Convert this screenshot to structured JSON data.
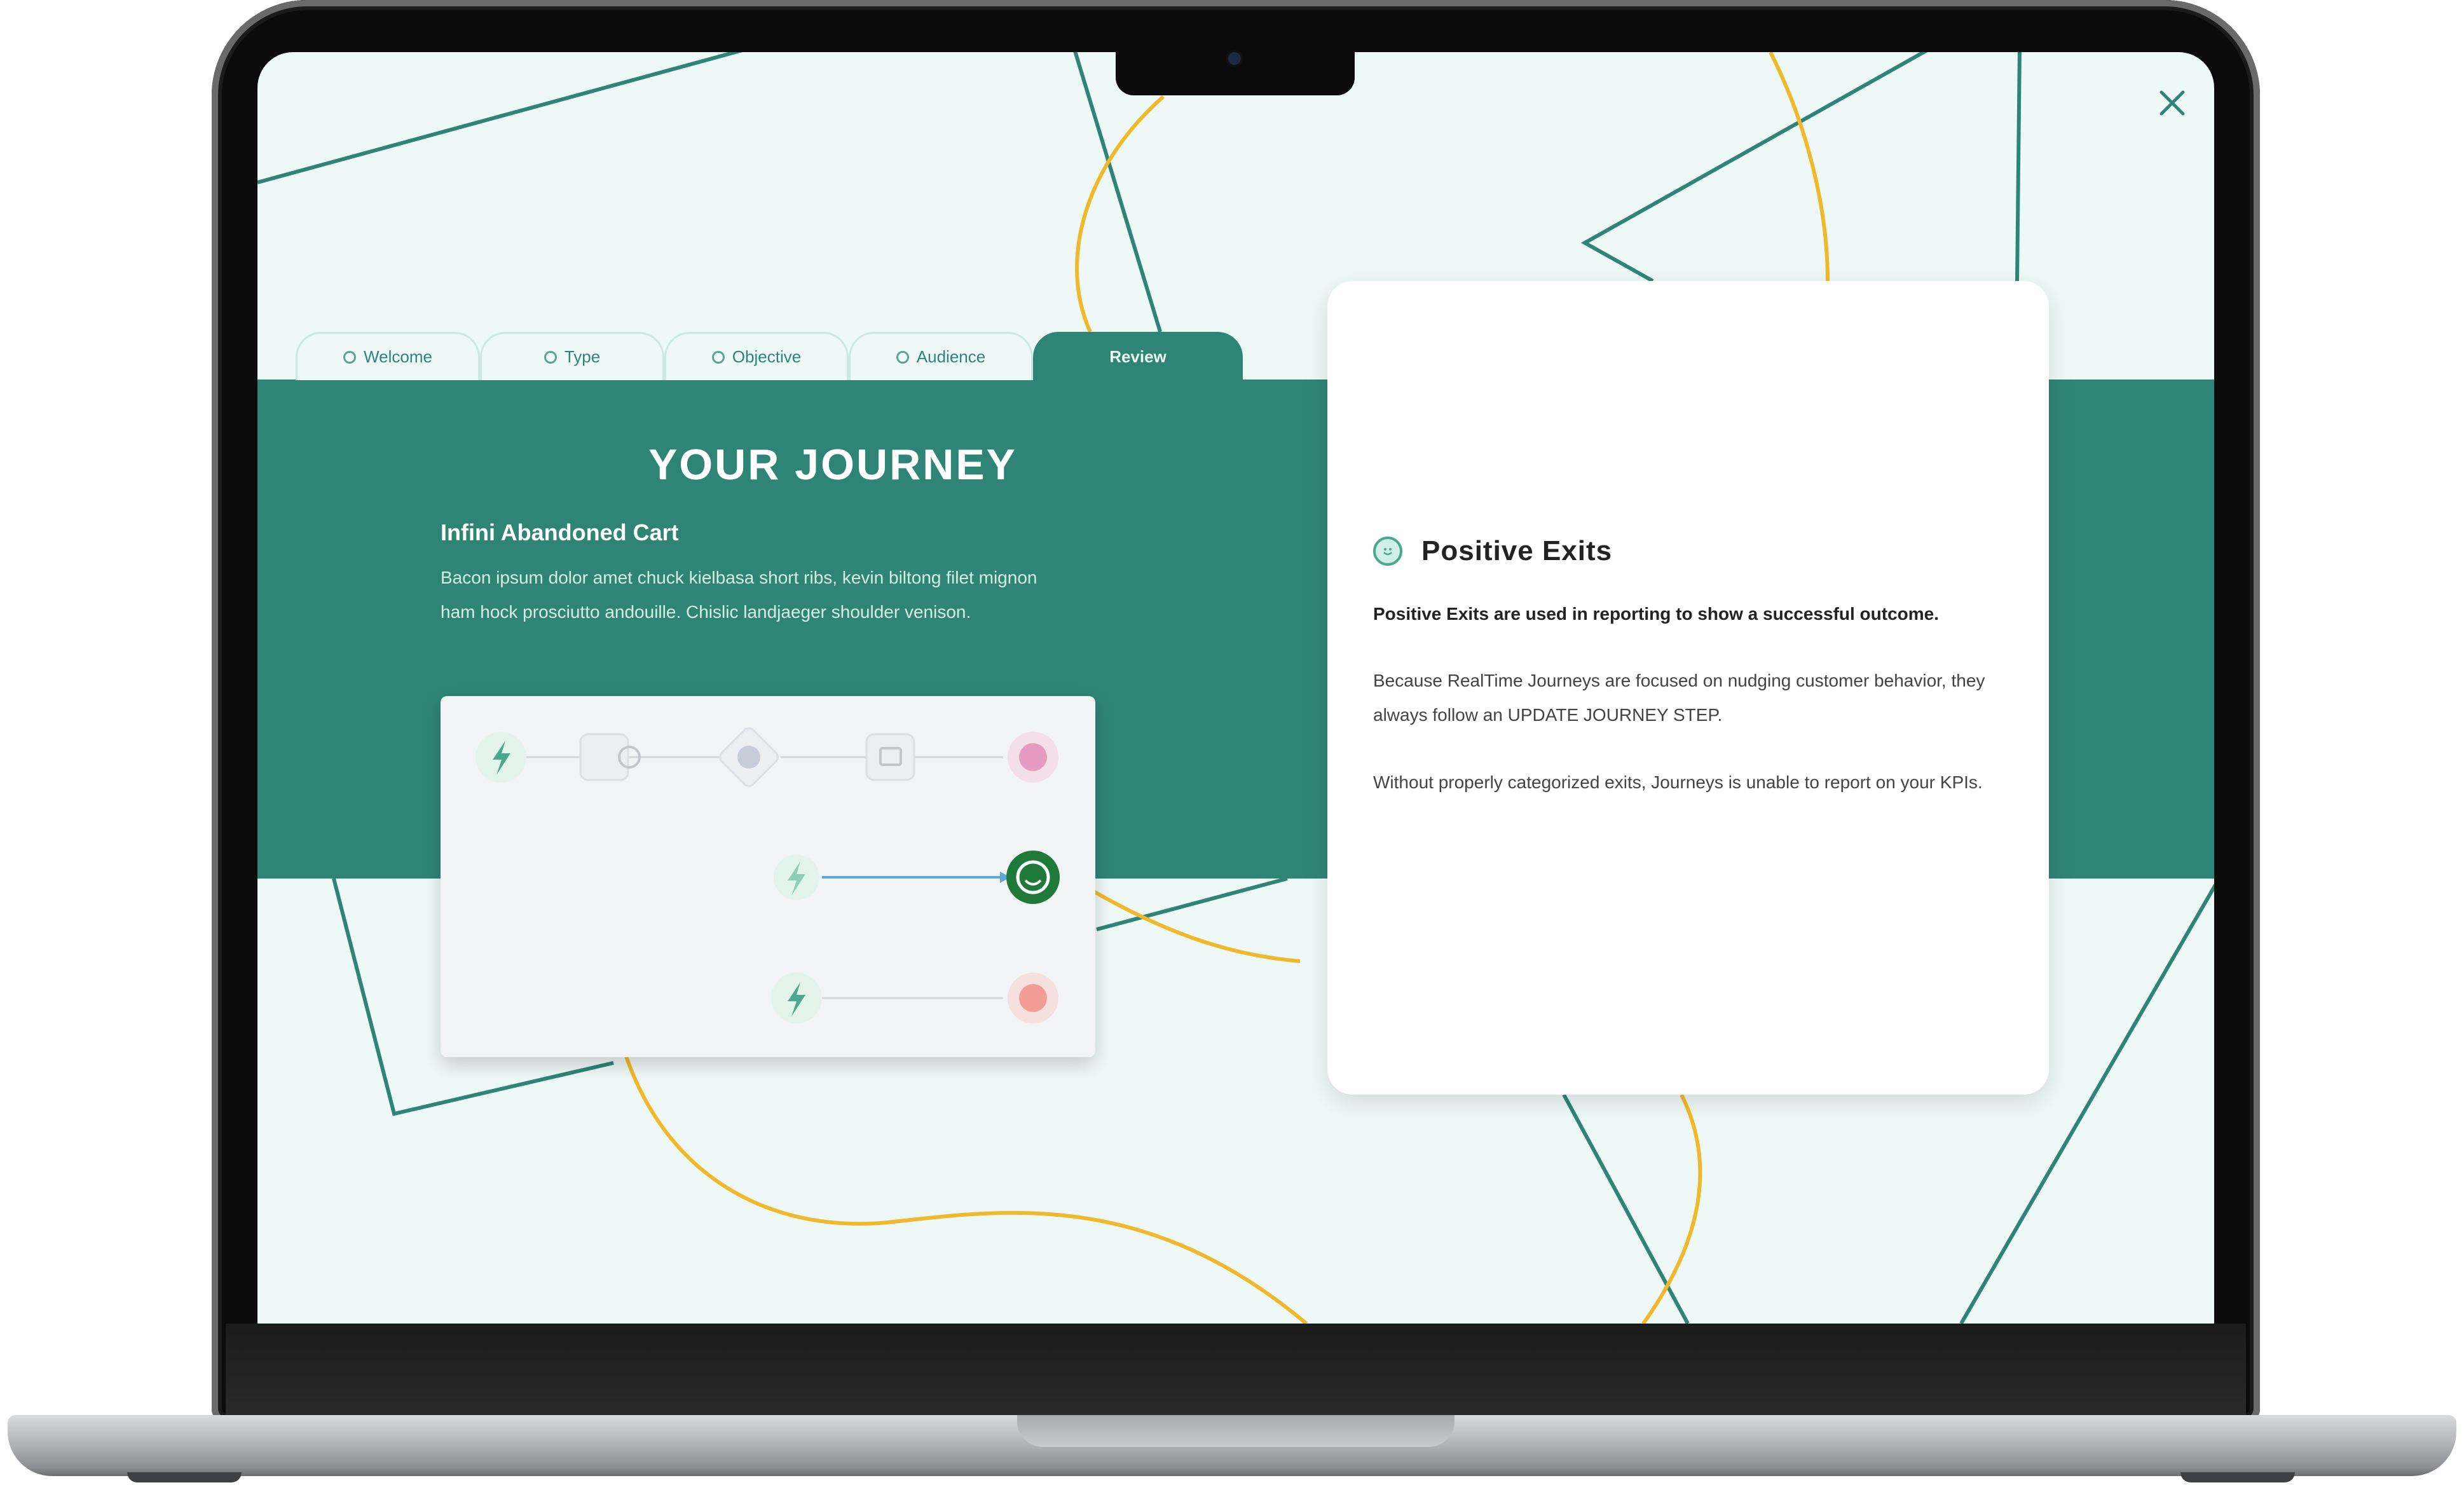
{
  "tabs": [
    {
      "label": "Welcome",
      "active": false
    },
    {
      "label": "Type",
      "active": false
    },
    {
      "label": "Objective",
      "active": false
    },
    {
      "label": "Audience",
      "active": false
    },
    {
      "label": "Review",
      "active": true
    }
  ],
  "journey": {
    "title": "YOUR JOURNEY",
    "name": "Infini Abandoned Cart",
    "description": "Bacon ipsum dolor amet chuck kielbasa short ribs, kevin biltong filet mignon ham hock prosciutto andouille. Chislic landjaeger shoulder venison."
  },
  "info": {
    "title": "Positive Exits",
    "lead": "Positive Exits are used in reporting to show a successful outcome.",
    "paragraph1": "Because RealTime Journeys are focused on nudging customer behavior, they always follow an UPDATE JOURNEY STEP.",
    "paragraph2": "Without properly categorized exits, Journeys is unable to report on your KPIs."
  },
  "colors": {
    "primary": "#2e8576",
    "background": "#eef8f6",
    "accent_yellow": "#f0b82b",
    "success_green": "#1f7a3a"
  },
  "icons": {
    "close": "close-icon",
    "trigger": "lightning-icon",
    "positive_exit": "smiley-icon"
  }
}
